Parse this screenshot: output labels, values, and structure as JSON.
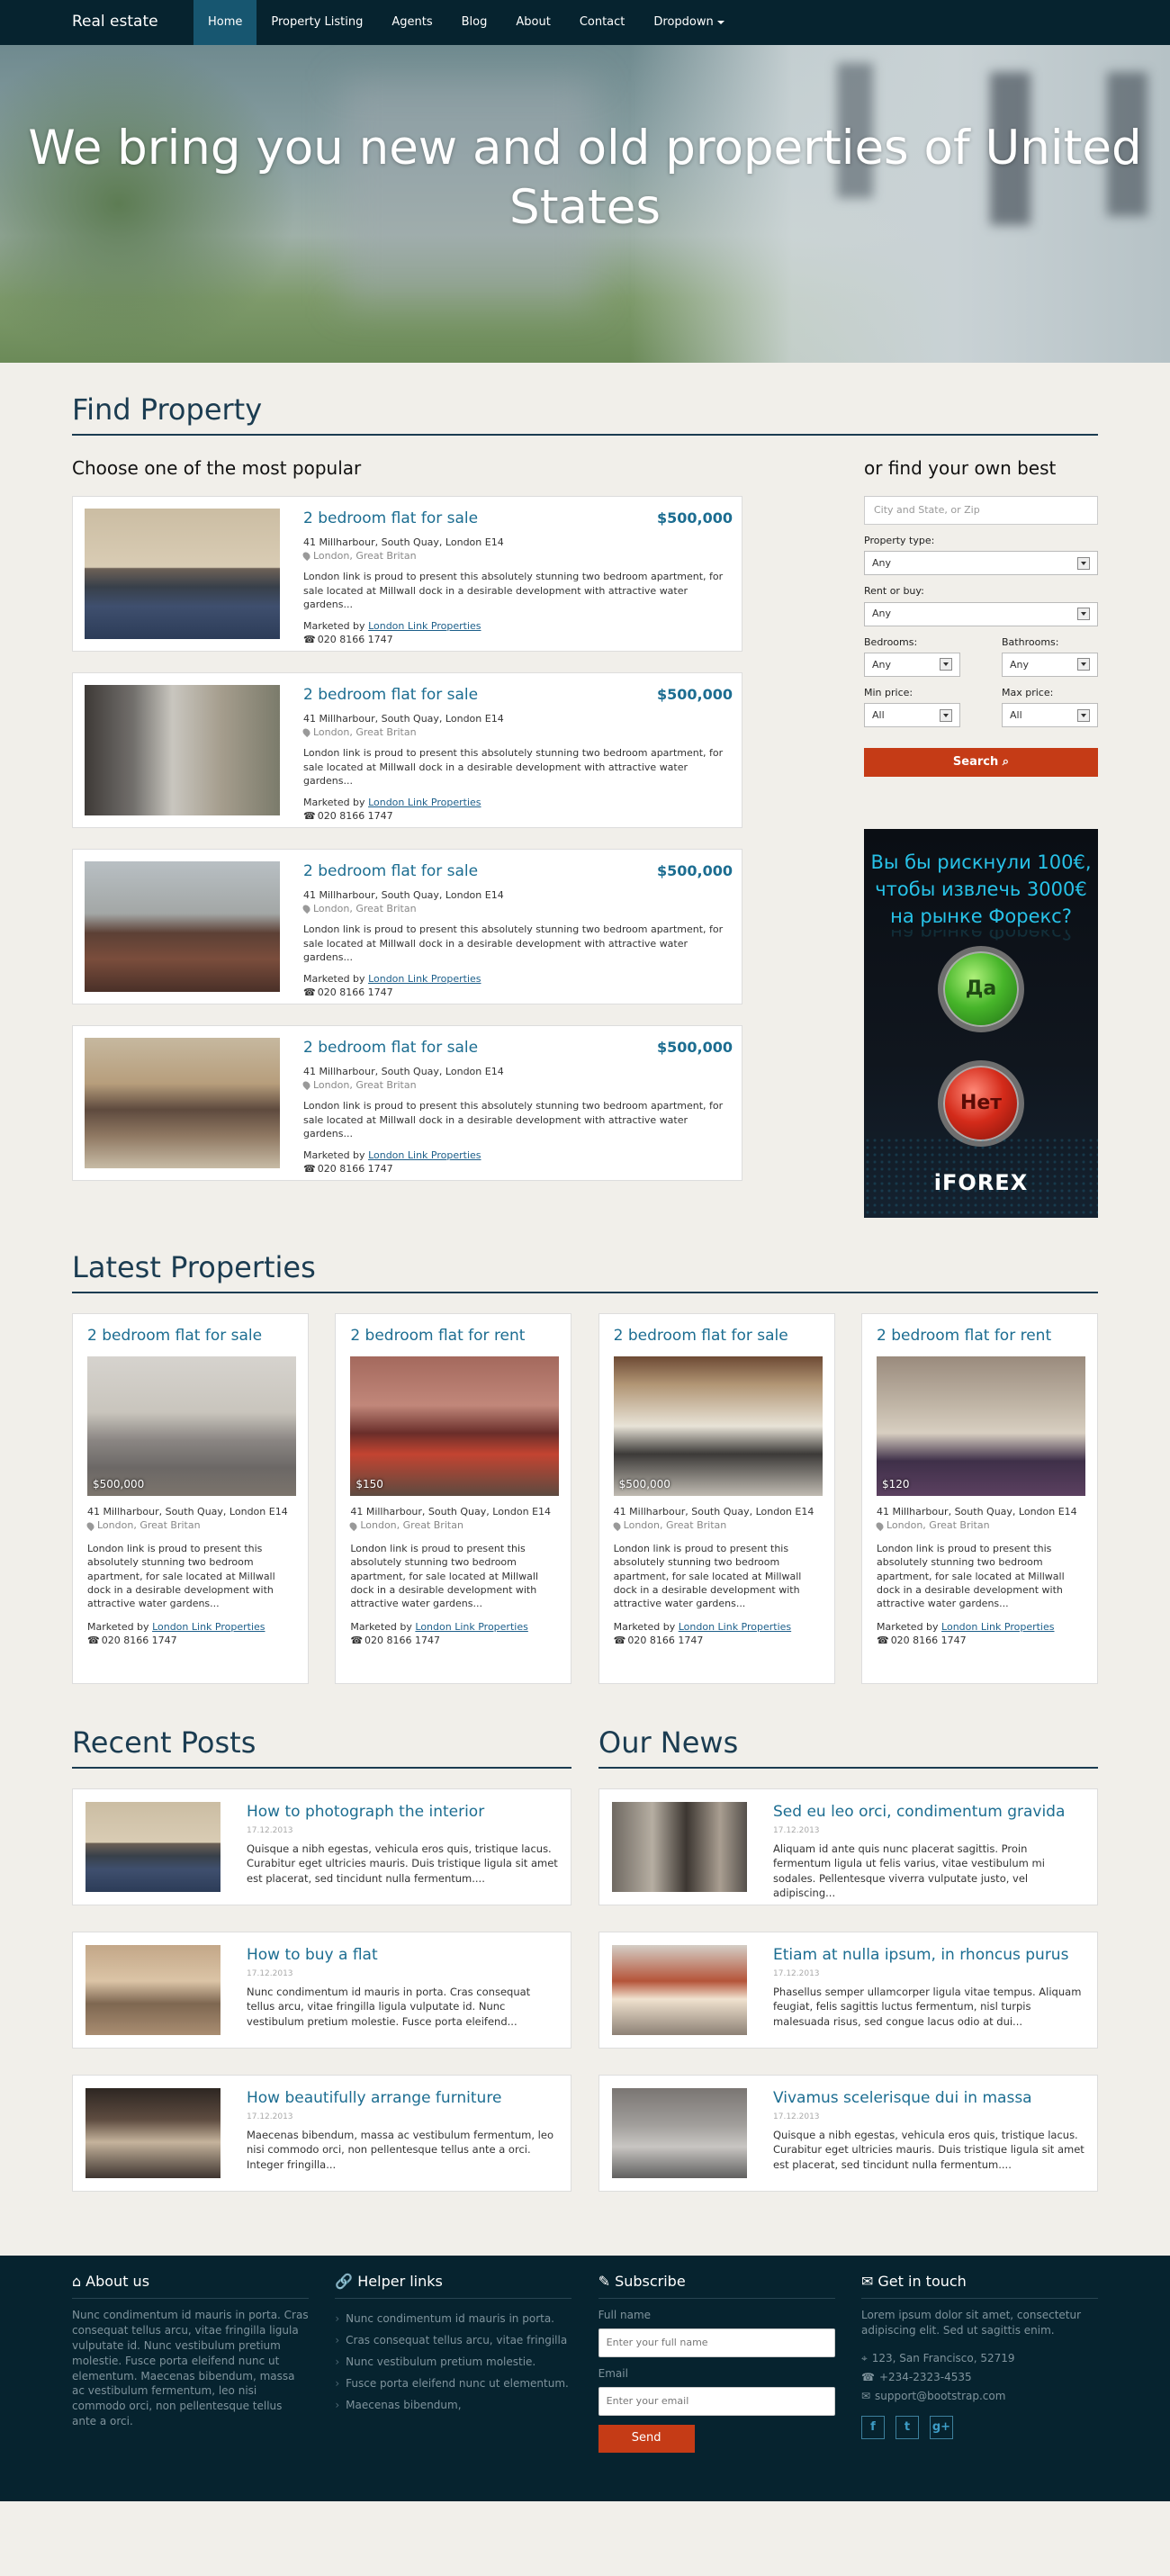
{
  "nav": {
    "brand": "Real estate",
    "items": [
      "Home",
      "Property Listing",
      "Agents",
      "Blog",
      "About",
      "Contact",
      "Dropdown"
    ]
  },
  "hero": {
    "title": "We bring you new and old properties of United States"
  },
  "find": {
    "title": "Find Property",
    "popular_title": "Choose one of the most popular",
    "own_title": "or find your own best",
    "properties": [
      {
        "title": "2 bedroom flat for sale",
        "price": "$500,000",
        "addr": "41 Millharbour, South Quay, London E14",
        "city": "London, Great Britan",
        "desc": "London link is proud to present this absolutely stunning two bedroom apartment, for sale located at Millwall dock in a desirable development with attractive water gardens...",
        "marketed": "Marketed by",
        "agent": "London Link Properties",
        "phone": "020 8166 1747"
      },
      {
        "title": "2 bedroom flat for sale",
        "price": "$500,000",
        "addr": "41 Millharbour, South Quay, London E14",
        "city": "London, Great Britan",
        "desc": "London link is proud to present this absolutely stunning two bedroom apartment, for sale located at Millwall dock in a desirable development with attractive water gardens...",
        "marketed": "Marketed by",
        "agent": "London Link Properties",
        "phone": "020 8166 1747"
      },
      {
        "title": "2 bedroom flat for sale",
        "price": "$500,000",
        "addr": "41 Millharbour, South Quay, London E14",
        "city": "London, Great Britan",
        "desc": "London link is proud to present this absolutely stunning two bedroom apartment, for sale located at Millwall dock in a desirable development with attractive water gardens...",
        "marketed": "Marketed by",
        "agent": "London Link Properties",
        "phone": "020 8166 1747"
      },
      {
        "title": "2 bedroom flat for sale",
        "price": "$500,000",
        "addr": "41 Millharbour, South Quay, London E14",
        "city": "London, Great Britan",
        "desc": "London link is proud to present this absolutely stunning two bedroom apartment, for sale located at Millwall dock in a desirable development with attractive water gardens...",
        "marketed": "Marketed by",
        "agent": "London Link Properties",
        "phone": "020 8166 1747"
      }
    ],
    "search": {
      "location_placeholder": "City and State, or Zip",
      "property_type_label": "Property type:",
      "property_type_value": "Any",
      "rent_buy_label": "Rent or buy:",
      "rent_buy_value": "Any",
      "bedrooms_label": "Bedrooms:",
      "bedrooms_value": "Any",
      "bathrooms_label": "Bathrooms:",
      "bathrooms_value": "Any",
      "min_price_label": "Min price:",
      "min_price_value": "All",
      "max_price_label": "Max price:",
      "max_price_value": "All",
      "button": "Search"
    },
    "ad": {
      "text": "Вы бы рискнули 100€, чтобы извлечь 3000€ на рынке Форекс?",
      "reflection": "на рынке Форекс?",
      "yes": "Да",
      "no": "Нет",
      "logo": "iFOREX"
    }
  },
  "latest": {
    "title": "Latest Properties",
    "items": [
      {
        "title": "2 bedroom flat for sale",
        "price": "$500,000",
        "addr": "41 Millharbour, South Quay, London E14",
        "city": "London, Great Britan",
        "desc": "London link is proud to present this absolutely stunning two bedroom apartment, for sale located at Millwall dock in a desirable development with attractive water gardens...",
        "marketed": "Marketed by",
        "agent": "London Link Properties",
        "phone": "020 8166 1747"
      },
      {
        "title": "2 bedroom flat for rent",
        "price": "$150",
        "addr": "41 Millharbour, South Quay, London E14",
        "city": "London, Great Britan",
        "desc": "London link is proud to present this absolutely stunning two bedroom apartment, for sale located at Millwall dock in a desirable development with attractive water gardens...",
        "marketed": "Marketed by",
        "agent": "London Link Properties",
        "phone": "020 8166 1747"
      },
      {
        "title": "2 bedroom flat for sale",
        "price": "$500,000",
        "addr": "41 Millharbour, South Quay, London E14",
        "city": "London, Great Britan",
        "desc": "London link is proud to present this absolutely stunning two bedroom apartment, for sale located at Millwall dock in a desirable development with attractive water gardens...",
        "marketed": "Marketed by",
        "agent": "London Link Properties",
        "phone": "020 8166 1747"
      },
      {
        "title": "2 bedroom flat for rent",
        "price": "$120",
        "addr": "41 Millharbour, South Quay, London E14",
        "city": "London, Great Britan",
        "desc": "London link is proud to present this absolutely stunning two bedroom apartment, for sale located at Millwall dock in a desirable development with attractive water gardens...",
        "marketed": "Marketed by",
        "agent": "London Link Properties",
        "phone": "020 8166 1747"
      }
    ]
  },
  "posts": {
    "title": "Recent Posts",
    "items": [
      {
        "title": "How to photograph the interior",
        "date": "17.12.2013",
        "text": "Quisque a nibh egestas, vehicula eros quis, tristique lacus. Curabitur eget ultricies mauris. Duis tristique ligula sit amet est placerat, sed tincidunt nulla fermentum...."
      },
      {
        "title": "How to buy a flat",
        "date": "17.12.2013",
        "text": "Nunc condimentum id mauris in porta. Cras consequat tellus arcu, vitae fringilla ligula vulputate id. Nunc vestibulum pretium molestie. Fusce porta eleifend..."
      },
      {
        "title": "How beautifully arrange furniture",
        "date": "17.12.2013",
        "text": "Maecenas bibendum, massa ac vestibulum fermentum, leo nisi commodo orci, non pellentesque tellus ante a orci. Integer fringilla..."
      }
    ]
  },
  "news": {
    "title": "Our News",
    "items": [
      {
        "title": "Sed eu leo orci, condimentum gravida",
        "date": "17.12.2013",
        "text": "Aliquam id ante quis nunc placerat sagittis. Proin fermentum ligula ut felis varius, vitae vestibulum mi sodales. Pellentesque viverra vulputate justo, vel adipiscing..."
      },
      {
        "title": "Etiam at nulla ipsum, in rhoncus purus",
        "date": "17.12.2013",
        "text": "Phasellus semper ullamcorper ligula vitae tempus. Aliquam feugiat, felis sagittis luctus fermentum, nisl turpis malesuada risus, sed congue lacus odio at dui..."
      },
      {
        "title": "Vivamus scelerisque dui in massa",
        "date": "17.12.2013",
        "text": "Quisque a nibh egestas, vehicula eros quis, tristique lacus. Curabitur eget ultricies mauris. Duis tristique ligula sit amet est placerat, sed tincidunt nulla fermentum...."
      }
    ]
  },
  "footer": {
    "about_title": "About us",
    "about_text": "Nunc condimentum id mauris in porta. Cras consequat tellus arcu, vitae fringilla ligula vulputate id. Nunc vestibulum pretium molestie. Fusce porta eleifend nunc ut elementum. Maecenas bibendum, massa ac vestibulum fermentum, leo nisi commodo orci, non pellentesque tellus ante a orci.",
    "links_title": "Helper links",
    "links": [
      "Nunc condimentum id mauris in porta.",
      "Cras consequat tellus arcu, vitae fringilla",
      "Nunc vestibulum pretium molestie.",
      "Fusce porta eleifend nunc ut elementum.",
      "Maecenas bibendum,"
    ],
    "subscribe_title": "Subscribe",
    "name_label": "Full name",
    "name_placeholder": "Enter your full name",
    "email_label": "Email",
    "email_placeholder": "Enter your email",
    "send": "Send",
    "contact_title": "Get in touch",
    "contact_text": "Lorem ipsum dolor sit amet, consectetur adipiscing elit. Sed ut sagittis enim.",
    "address": "123, San Francisco, 52719",
    "phone": "+234-2323-4535",
    "email": "support@bootstrap.com",
    "social": [
      "f",
      "t",
      "g+"
    ]
  }
}
